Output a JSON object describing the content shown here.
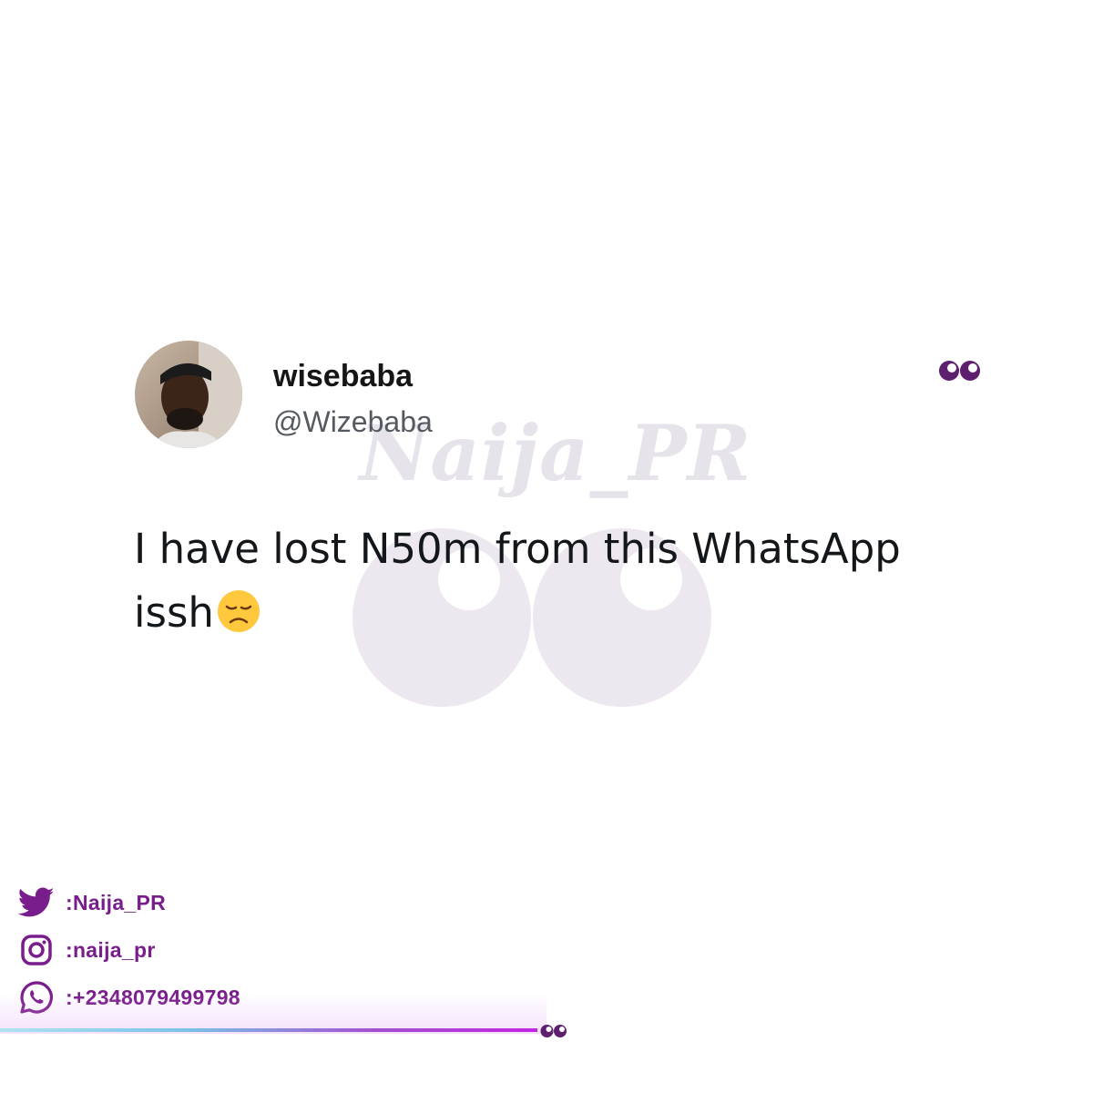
{
  "watermark": {
    "text": "Naija_PR"
  },
  "tweet": {
    "display_name": "wisebaba",
    "handle": "@Wizebaba",
    "text": "I have lost N50m from this WhatsApp issh",
    "emoji": "disappointed-face"
  },
  "socials": [
    {
      "icon": "twitter-icon",
      "label": ":Naija_PR"
    },
    {
      "icon": "instagram-icon",
      "label": ":naija_pr"
    },
    {
      "icon": "whatsapp-icon",
      "label": ":+2348079499798"
    }
  ],
  "colors": {
    "brand_purple": "#7a1d8c",
    "eyes_purple": "#6d2a7e",
    "watermark": "#e6e3ea"
  }
}
